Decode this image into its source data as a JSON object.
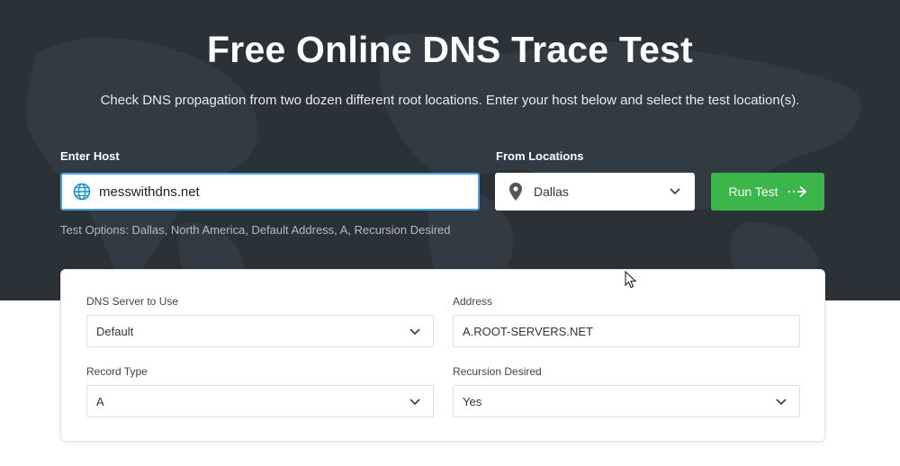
{
  "hero": {
    "title": "Free Online DNS Trace Test",
    "subtitle": "Check DNS propagation from two dozen different root locations. Enter your host below and select the test location(s)."
  },
  "host": {
    "label": "Enter Host",
    "value": "messwithdns.net",
    "icon": "globe-icon"
  },
  "locations": {
    "label": "From Locations",
    "selected": "Dallas",
    "icon": "map-pin-icon"
  },
  "run_button": {
    "label": "Run Test",
    "icon": "arrow-right-icon"
  },
  "test_options": "Test Options: Dallas, North America, Default Address, A, Recursion Desired",
  "options_card": {
    "dns_server": {
      "label": "DNS Server to Use",
      "selected": "Default"
    },
    "address": {
      "label": "Address",
      "value": "A.ROOT-SERVERS.NET"
    },
    "record_type": {
      "label": "Record Type",
      "selected": "A"
    },
    "recursion": {
      "label": "Recursion Desired",
      "selected": "Yes"
    }
  },
  "colors": {
    "hero_bg": "#2a3238",
    "accent_blue": "#4aa3df",
    "button_green": "#3cb54a"
  }
}
